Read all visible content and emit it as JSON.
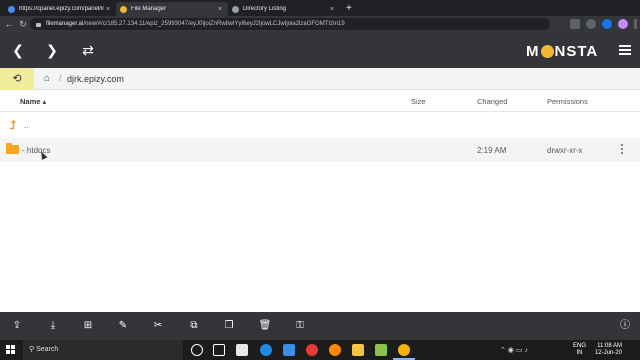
{
  "browser": {
    "tabs": [
      {
        "title": "https://cpanel.epizy.com/panel/in",
        "favicon_color": "#4c8bf5",
        "active": false
      },
      {
        "title": "File Manager",
        "favicon_color": "#f2b632",
        "active": true
      },
      {
        "title": "Directory Listing",
        "favicon_color": "#9aa0a6",
        "active": false
      }
    ],
    "close_glyph": "×",
    "new_tab_glyph": "+",
    "url_domain": "filemanager.ai",
    "url_path": "/new/#/c/185.27.134.11/epiz_25993047/eyJ0IjoiZnRwIiwiYyI6eyJ2IjowLCJwIjoia2lzaGFOMTIzIn19",
    "nav": {
      "back": "←",
      "forward": "→",
      "reload": "↻"
    }
  },
  "app": {
    "logo": {
      "pre": "M",
      "post": "NSTA"
    },
    "header_nav": {
      "back": "❮",
      "forward": "❯",
      "refresh": "⇄"
    },
    "history_icon": "⟲",
    "home_icon": "⌂",
    "breadcrumb_separator": "/",
    "breadcrumb": "djrk.epizy.com",
    "columns": {
      "name": "Name ▴",
      "size": "Size",
      "changed": "Changed",
      "permissions": "Permissions"
    },
    "parent_row": {
      "icon": "⮥",
      "name": ".."
    },
    "rows": [
      {
        "name": "htdocs",
        "size": "",
        "changed": "2:19 AM",
        "permissions": "drwxr-xr-x"
      }
    ],
    "toolbar": [
      {
        "name": "upload-icon",
        "glyph": "⇪"
      },
      {
        "name": "download-icon",
        "glyph": "⤓"
      },
      {
        "name": "new-item-icon",
        "glyph": "⊞"
      },
      {
        "name": "edit-icon",
        "glyph": "✎"
      },
      {
        "name": "cut-icon",
        "glyph": "✂"
      },
      {
        "name": "copy-icon",
        "glyph": "⧉"
      },
      {
        "name": "paste-icon",
        "glyph": "❐"
      },
      {
        "name": "delete-icon",
        "glyph": "🗑"
      },
      {
        "name": "permissions-icon",
        "glyph": "⚿"
      }
    ],
    "info_glyph": "ⓘ"
  },
  "taskbar": {
    "search_label": "Search",
    "lang_line1": "ENG",
    "lang_line2": "IN",
    "time": "11:08 AM",
    "date": "12-Jun-20",
    "tray_glyphs": "⌃ ◉ ▭ ♪"
  },
  "colors": {
    "header_bg": "#333538",
    "accent_yellow": "#f2b632",
    "folder": "#f5a623",
    "history_bg": "#f0ec9c"
  }
}
